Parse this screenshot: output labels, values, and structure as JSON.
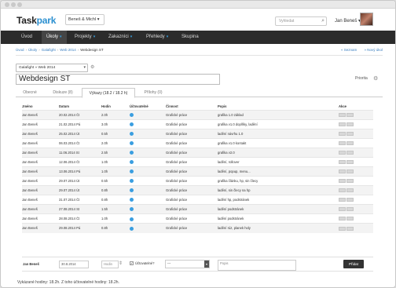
{
  "brand": {
    "logo_a": "Task",
    "logo_b": "park"
  },
  "company": "Beneš & Michl",
  "search": {
    "placeholder": "Vyhledat"
  },
  "user": {
    "name": "Jan Beneš"
  },
  "nav": [
    {
      "label": "Úvod",
      "dropdown": false
    },
    {
      "label": "Úkoly",
      "dropdown": true
    },
    {
      "label": "Projekty",
      "dropdown": true
    },
    {
      "label": "Zakazníci",
      "dropdown": true
    },
    {
      "label": "Přehledy",
      "dropdown": true
    },
    {
      "label": "Skupina",
      "dropdown": false
    }
  ],
  "breadcrumb": [
    "Úvod",
    "Úkoly",
    "Galafight",
    "Web 2014",
    "Webdesign ST"
  ],
  "pager": {
    "prev": "« Seznam",
    "next": "» Nový úkol"
  },
  "project_select": "Galafight » Web 2014",
  "task_title": "Webdesign ST",
  "priority_label": "Priorita",
  "tabs": [
    "Obecné",
    "Diskuze (8)",
    "Výkazy (18.2 / 18.2 h)",
    "Přílohy (0)"
  ],
  "table": {
    "headers": [
      "Jméno",
      "Datum",
      "Hodin",
      "Účtovatelné",
      "Činnost",
      "Popis",
      "Akce"
    ],
    "rows": [
      [
        "Jan Beneš",
        "20.02.2014 Čt",
        "2.0h",
        true,
        "Grafické práce",
        "grafika 1.0 základ"
      ],
      [
        "Jan Beneš",
        "21.02.2014 Pá",
        "3.0h",
        true,
        "Grafické práce",
        "grafika v1.0 doplňky, ladění"
      ],
      [
        "Jan Beneš",
        "25.02.2014 Út",
        "0.5h",
        true,
        "Grafické práce",
        "ladění návrhu 1.0"
      ],
      [
        "Jan Beneš",
        "06.03.2014 Čt",
        "2.0h",
        true,
        "Grafické práce",
        "grafika v1.0 kontakt"
      ],
      [
        "Jan Beneš",
        "11.06.2014 St",
        "2.5h",
        true,
        "Grafické práce",
        "grafika v2.0"
      ],
      [
        "Jan Beneš",
        "12.06.2014 Čt",
        "1.0h",
        true,
        "Grafické práce",
        "ladění, rollover"
      ],
      [
        "Jan Beneš",
        "13.06.2014 Pá",
        "1.0h",
        true,
        "Grafické práce",
        "ladění, popup, menu..."
      ],
      [
        "Jan Beneš",
        "29.07.2014 Út",
        "0.5h",
        true,
        "Grafické práce",
        "grafika článku, hp, sin člecy"
      ],
      [
        "Jan Beneš",
        "29.07.2014 Út",
        "0.8h",
        true,
        "Grafické práce",
        "ladění, sin člecy na hp"
      ],
      [
        "Jan Beneš",
        "31.07.2014 Čt",
        "0.8h",
        true,
        "Grafické práce",
        "ladění hp, podstránek"
      ],
      [
        "Jan Beneš",
        "27.08.2014 St",
        "1.5h",
        true,
        "Grafické práce",
        "ladění podstránek"
      ],
      [
        "Jan Beneš",
        "28.08.2014 Čt",
        "1.0h",
        true,
        "Grafické práce",
        "ladění podstránek"
      ],
      [
        "Jan Beneš",
        "29.08.2014 Pá",
        "0.8h",
        true,
        "Grafické práce",
        "ladění rúz, planek holy"
      ]
    ]
  },
  "add_row": {
    "name": "Jan Beneš",
    "date": "30.8.2014",
    "hours_placeholder": "Hodin",
    "billable_label": "Účtovatelné?",
    "activity": "---",
    "desc_placeholder": "Popis",
    "submit": "Přidat"
  },
  "footer_text": "Vykázané hodiny: 18.2h. Z toho účtovatelné hodiny: 18.2h."
}
